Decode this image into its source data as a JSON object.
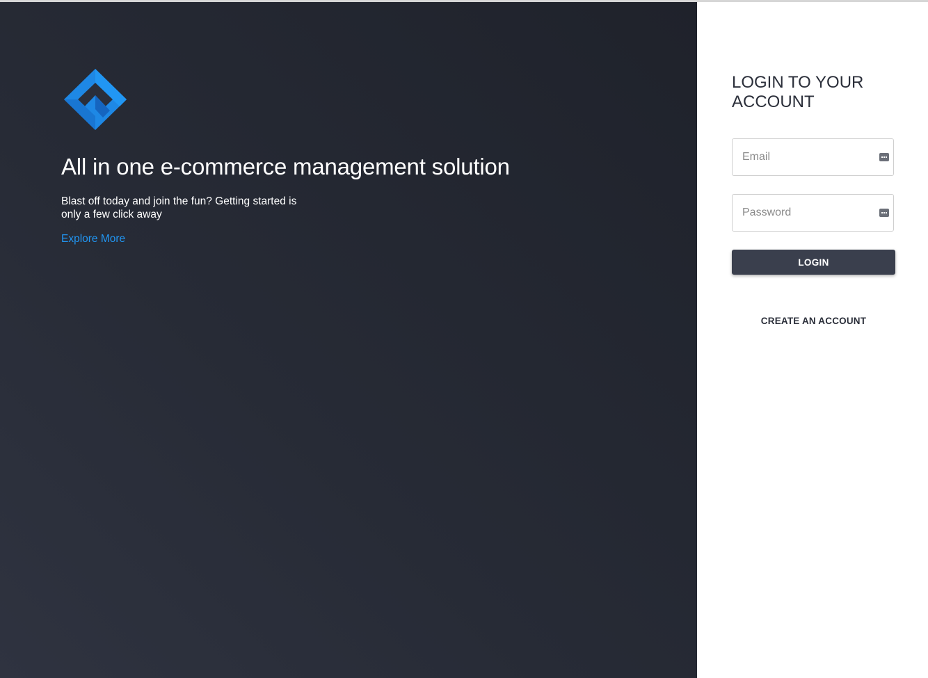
{
  "hero": {
    "headline": "All in one e-commerce management solution",
    "subtext": "Blast off today and join the fun? Getting started is only a few click away",
    "explore_link": "Explore More",
    "logo_icon": "diamond-stack-logo-icon"
  },
  "login": {
    "title": "LOGIN TO YOUR ACCOUNT",
    "email": {
      "placeholder": "Email",
      "value": ""
    },
    "password": {
      "placeholder": "Password",
      "value": ""
    },
    "login_label": "LOGIN",
    "create_account_label": "CREATE AN ACCOUNT"
  },
  "colors": {
    "hero_background": "#272b36",
    "accent_link": "#2196f3",
    "button": "#3a3f4d",
    "logo_blue": "#1e88e5"
  }
}
